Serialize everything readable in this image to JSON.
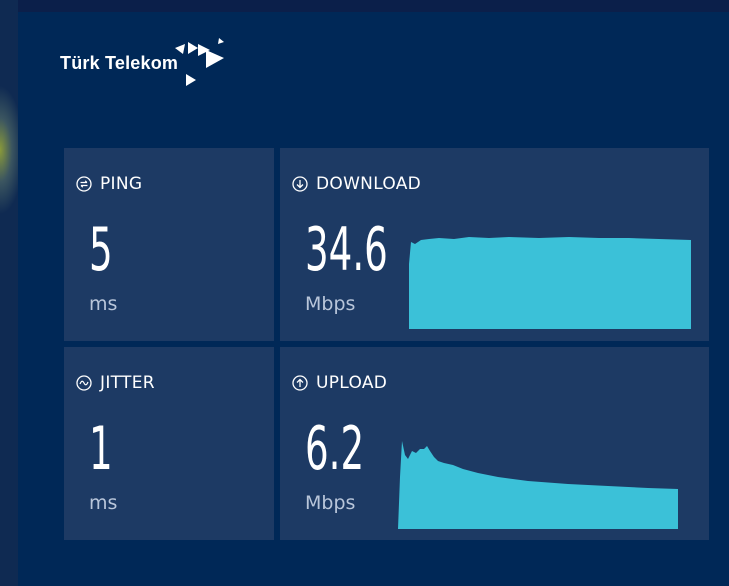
{
  "brand": {
    "name": "Türk Telekom"
  },
  "colors": {
    "panel": "#002857",
    "card": "#1d3a64",
    "graph": "#3bc1d8",
    "text": "#ffffff",
    "unit": "#b9c6da"
  },
  "metrics": {
    "ping": {
      "label": "PING",
      "value": "5",
      "unit": "ms",
      "icon": "ping-icon"
    },
    "download": {
      "label": "DOWNLOAD",
      "value": "34.6",
      "unit": "Mbps",
      "icon": "arrow-down-circle-icon"
    },
    "jitter": {
      "label": "JITTER",
      "value": "1",
      "unit": "ms",
      "icon": "wave-circle-icon"
    },
    "upload": {
      "label": "UPLOAD",
      "value": "6.2",
      "unit": "Mbps",
      "icon": "arrow-up-circle-icon"
    }
  }
}
